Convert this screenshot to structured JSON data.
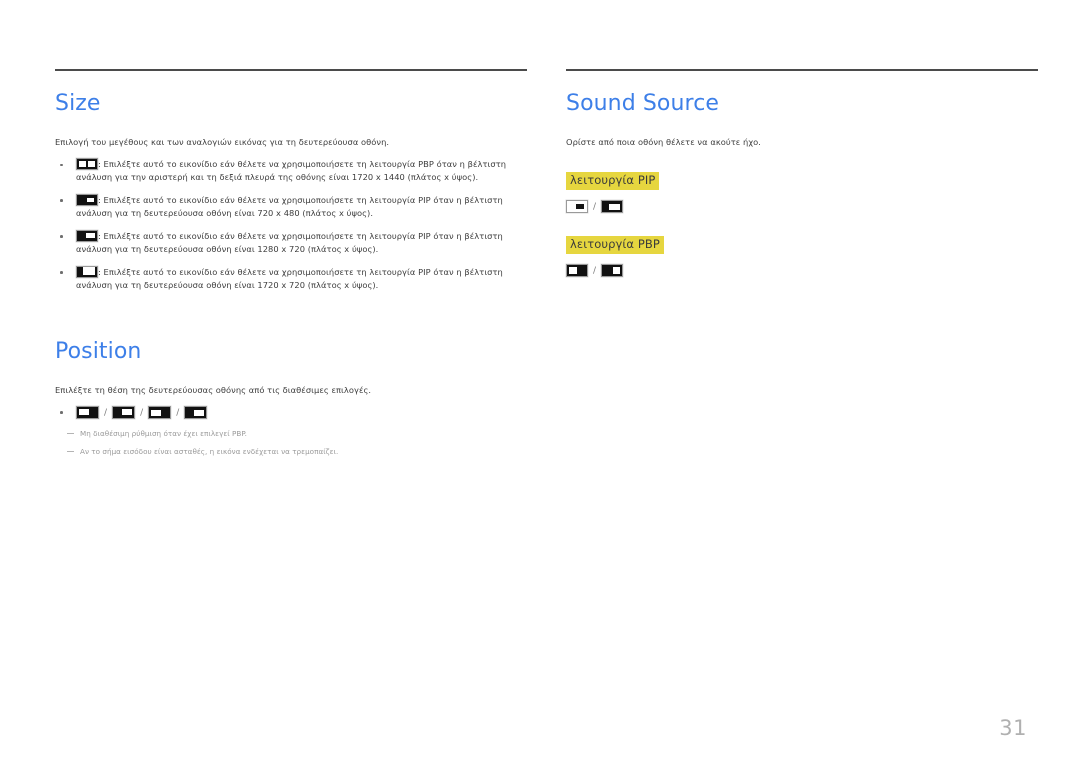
{
  "page": {
    "number": "31"
  },
  "left_column": {
    "sections": [
      {
        "title": "Size",
        "intro": "Επιλογή του μεγέθους και των αναλογιών εικόνας για τη δευτερεύουσα οθόνη.",
        "bullets": [
          {
            "icon": "pbp-half-split-icon",
            "text": ": Επιλέξτε αυτό το εικονίδιο εάν θέλετε να χρησιμοποιήσετε τη λειτουργία PBP όταν η βέλτιστη ανάλυση για την αριστερή και τη δεξιά πλευρά της οθόνης είναι 1720 x 1440 (πλάτος x ύψος)."
          },
          {
            "icon": "pip-small-icon",
            "text": ": Επιλέξτε αυτό το εικονίδιο εάν θέλετε να χρησιμοποιήσετε τη λειτουργία PIP όταν η βέλτιστη ανάλυση για τη δευτερεύουσα οθόνη είναι 720 x 480 (πλάτος x ύψος)."
          },
          {
            "icon": "pip-medium-icon",
            "text": ": Επιλέξτε αυτό το εικονίδιο εάν θέλετε να χρησιμοποιήσετε τη λειτουργία PIP όταν η βέλτιστη ανάλυση για τη δευτερεύουσα οθόνη είναι 1280 x 720 (πλάτος x ύψος)."
          },
          {
            "icon": "pip-large-icon",
            "text": ": Επιλέξτε αυτό το εικονίδιο εάν θέλετε να χρησιμοποιήσετε τη λειτουργία PIP όταν η βέλτιστη ανάλυση για τη δευτερεύουσα οθόνη είναι 1720 x 720 (πλάτος x ύψος)."
          }
        ]
      },
      {
        "title": "Position",
        "intro": "Επιλέξτε τη θέση της δευτερεύουσας οθόνης από τις διαθέσιμες επιλογές.",
        "position_icons": [
          "position-top-left-icon",
          "position-top-right-icon",
          "position-bottom-left-icon",
          "position-bottom-right-icon"
        ],
        "separator": "/",
        "notes": [
          "Μη διαθέσιμη ρύθμιση όταν έχει επιλεγεί PBP.",
          "Αν το σήμα εισόδου είναι ασταθές, η εικόνα ενδέχεται να τρεμοπαίζει."
        ]
      }
    ]
  },
  "right_column": {
    "sections": [
      {
        "title": "Sound Source",
        "intro": "Ορίστε από ποια οθόνη θέλετε να ακούτε ήχο.",
        "groups": [
          {
            "label": "λειτουργία PIP",
            "icons": [
              "sound-pip-main-icon",
              "sound-pip-sub-icon"
            ],
            "separator": "/"
          },
          {
            "label": "λειτουργία PBP",
            "icons": [
              "sound-pbp-left-icon",
              "sound-pbp-right-icon"
            ],
            "separator": "/"
          }
        ]
      }
    ]
  },
  "colors": {
    "heading": "#3d7fe8",
    "highlight": "#e6d63f",
    "body_text": "#3b3b3b",
    "note_text": "#9a9a9a",
    "rule": "#4b4b4b",
    "page_number": "#b0b0b0"
  }
}
